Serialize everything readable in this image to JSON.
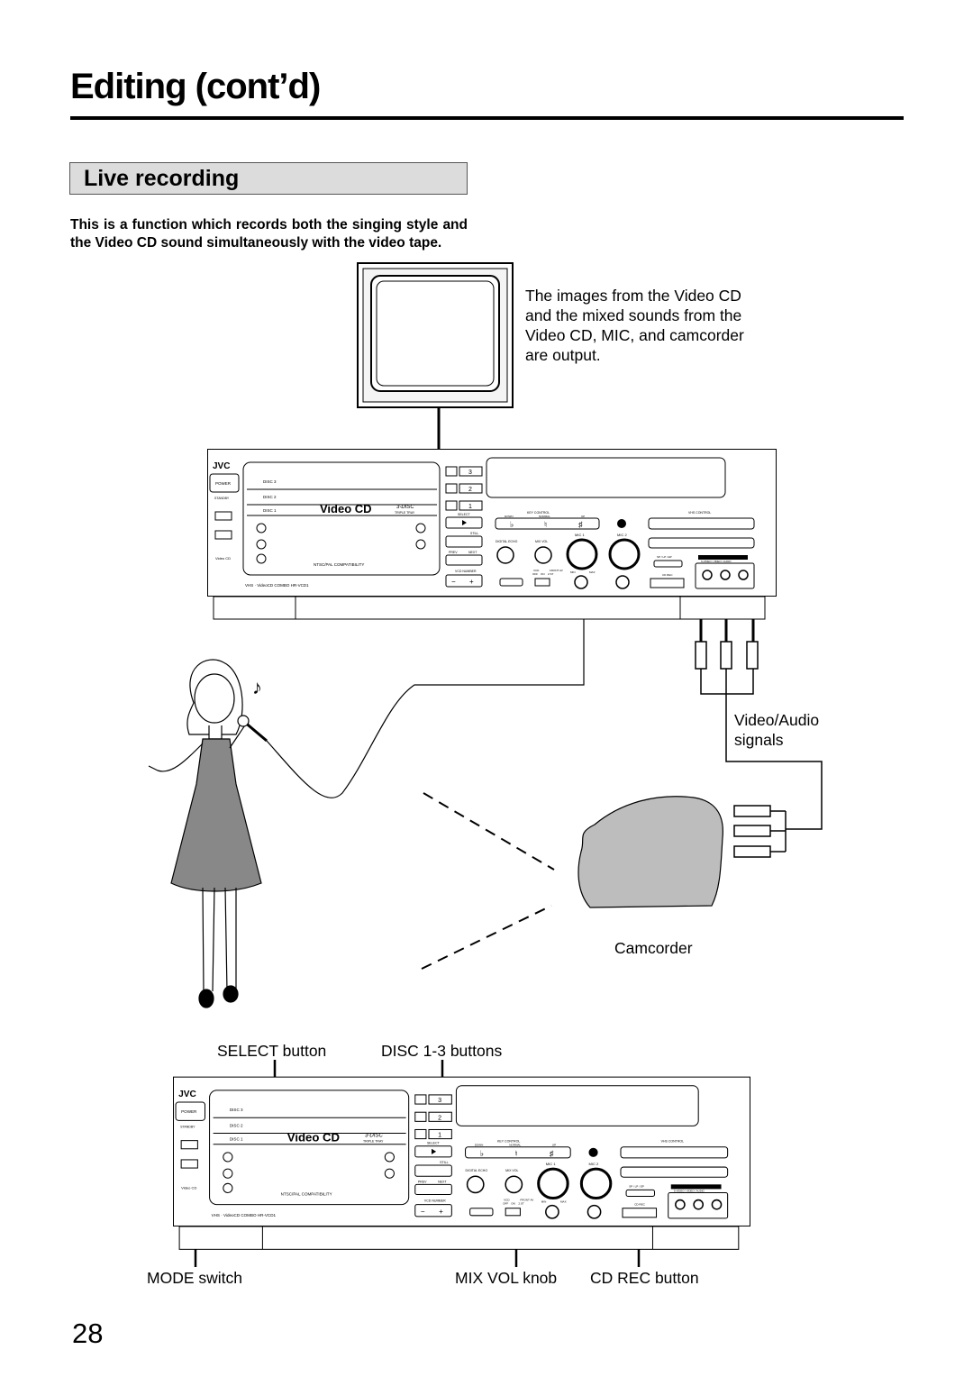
{
  "page": {
    "title": "Editing (cont’d)",
    "section_title": "Live recording",
    "intro": "This is a function which records both the singing style and the Video CD sound simultaneously with the video tape.",
    "page_number": "28"
  },
  "diagram": {
    "tv_caption": "The images from the Video CD and the mixed sounds from the Video CD, MIC, and camcorder are output.",
    "signals_caption_1": "Video/Audio",
    "signals_caption_2": "signals",
    "camcorder_caption": "Camcorder",
    "callouts": {
      "select": "SELECT button",
      "disc": "DISC 1-3 buttons",
      "mode": "MODE switch",
      "mixvol": "MIX VOL knob",
      "cdrec": "CD REC button"
    }
  },
  "device": {
    "brand": "JVC",
    "power": "POWER",
    "standby": "STANDBY",
    "disc3": "DISC 3",
    "disc2": "DISC 2",
    "disc1": "DISC 1",
    "videocd": "Video CD",
    "three_disc": "3-DISC",
    "triple_tray": "TRIPLE TRAY",
    "ntsc_pal": "NTSC/PAL COMPATIBILITY",
    "model": "VHS · VideoCD COMBO  HR-VCD1",
    "eject_labels": [
      "3",
      "2",
      "1"
    ],
    "select": "SELECT",
    "still": "STILL",
    "prev": "PREV",
    "next": "NEXT",
    "vcd_number": "VCD NUMBER",
    "minus": "−",
    "plus": "+",
    "key_control": "KEY CONTROL",
    "key_down": "DOWN",
    "key_normal": "NORMAL",
    "key_up": "UP",
    "flat": "♭",
    "natural": "♮",
    "sharp": "♯",
    "vhs_control": "VHS CONTROL",
    "digital_echo": "DIGITAL ECHO",
    "mix_vol": "MIX VOL",
    "mic1": "MIC 1",
    "mic2": "MIC 2",
    "min": "MIN",
    "max": "MAX",
    "vcd": "VCD",
    "front_av": "FRONT AV",
    "mode_off": "OFF",
    "mode_on": "ON",
    "mode_2st": "2.ST",
    "sp_lp_ep": "SP / LP / EP",
    "cd_rec": "CD REC",
    "av_recording": "S-VIDEO / VIDEO / AUDIO"
  }
}
